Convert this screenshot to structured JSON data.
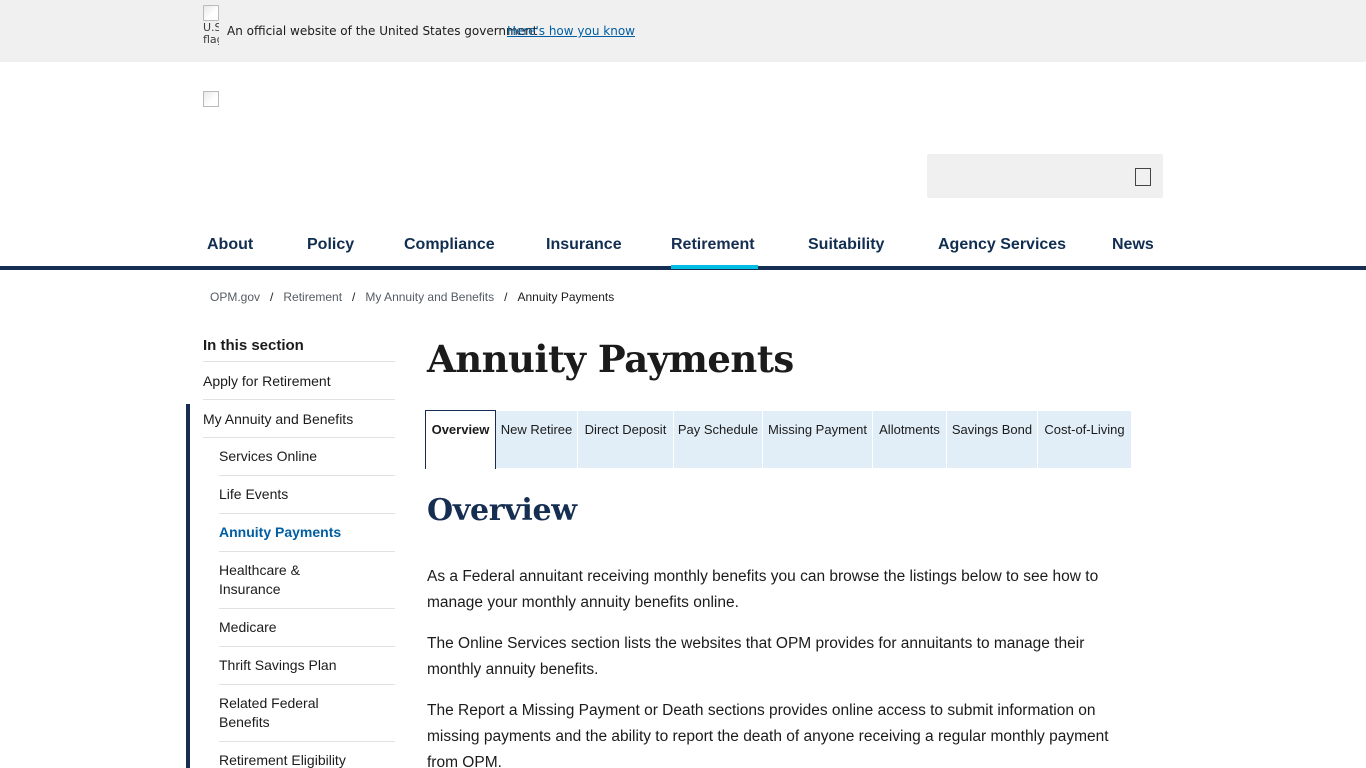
{
  "gov_banner": {
    "flag_alt": "U.S. flag",
    "text": "An official website of the United States government",
    "link": "Here's how you know"
  },
  "search": {
    "placeholder": ""
  },
  "nav": {
    "items": [
      {
        "label": "About"
      },
      {
        "label": "Policy"
      },
      {
        "label": "Compliance"
      },
      {
        "label": "Insurance"
      },
      {
        "label": "Retirement",
        "active": true
      },
      {
        "label": "Suitability"
      },
      {
        "label": "Agency Services"
      },
      {
        "label": "News"
      }
    ]
  },
  "breadcrumb": {
    "items": [
      "OPM.gov",
      "Retirement",
      "My Annuity and Benefits"
    ],
    "current": "Annuity Payments",
    "separator": "/"
  },
  "sidenav": {
    "title": "In this section",
    "top_items": [
      "Apply for Retirement",
      "My Annuity and Benefits"
    ],
    "sub_items": [
      {
        "label": "Services Online"
      },
      {
        "label": "Life Events"
      },
      {
        "label": "Annuity Payments",
        "active": true
      },
      {
        "label": "Healthcare & Insurance"
      },
      {
        "label": "Medicare"
      },
      {
        "label": "Thrift Savings Plan"
      },
      {
        "label": "Related Federal Benefits"
      },
      {
        "label": "Retirement Eligibility Surveys"
      }
    ]
  },
  "page": {
    "title": "Annuity Payments"
  },
  "tabs": [
    {
      "label": "Overview",
      "active": true
    },
    {
      "label": "New Retiree"
    },
    {
      "label": "Direct Deposit"
    },
    {
      "label": "Pay Schedule"
    },
    {
      "label": "Missing Payment"
    },
    {
      "label": "Allotments"
    },
    {
      "label": "Savings Bond"
    },
    {
      "label": "Cost-of-Living"
    }
  ],
  "content": {
    "heading": "Overview",
    "paragraphs": [
      "As a Federal annuitant receiving monthly benefits you can browse the listings below to see how to manage your monthly annuity benefits online.",
      "The Online Services section lists the websites that OPM provides for annuitants to manage their monthly annuity benefits.",
      "The Report a Missing Payment or Death sections provides online access to submit information on missing payments and the ability to report the death of anyone receiving a regular monthly payment from OPM."
    ]
  },
  "colors": {
    "navy": "#162e51",
    "link_blue": "#005ea2",
    "accent_cyan": "#00bde3",
    "tab_bg": "#e1eef8"
  },
  "icons": {
    "search": "search-icon",
    "flag": "us-flag-icon",
    "logo": "opm-logo"
  }
}
